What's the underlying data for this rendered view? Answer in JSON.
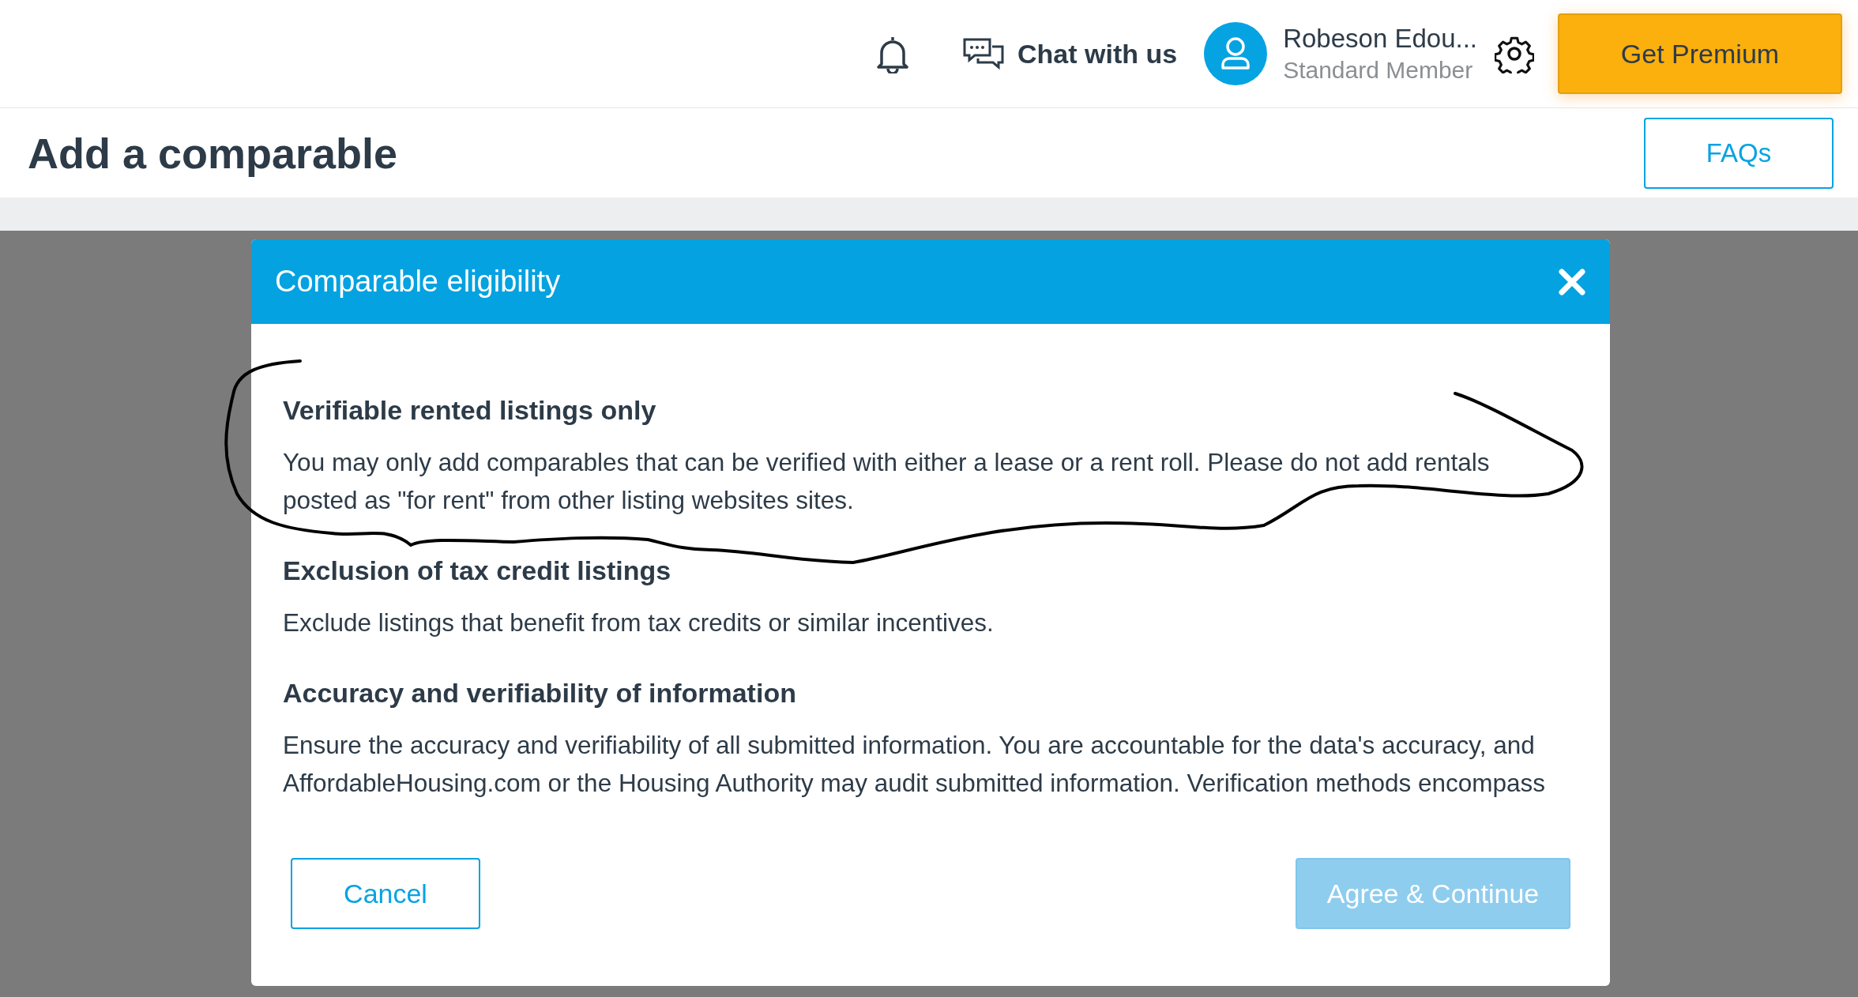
{
  "topbar": {
    "chat_label": "Chat with us",
    "user_name": "Robeson Edou...",
    "user_role": "Standard Member",
    "premium_button": "Get Premium"
  },
  "page": {
    "title": "Add a comparable",
    "faqs_button": "FAQs"
  },
  "modal": {
    "title": "Comparable eligibility",
    "sections": [
      {
        "heading": "Verifiable rented listings only",
        "text": "You may only add comparables that can be verified with either a lease or a rent roll. Please do not add rentals posted as \"for rent\" from other listing websites sites."
      },
      {
        "heading": "Exclusion of tax credit listings",
        "text": "Exclude listings that benefit from tax credits or similar incentives."
      },
      {
        "heading": "Accuracy and verifiability of information",
        "text": "Ensure the accuracy and verifiability of all submitted information. You are accountable for the data's accuracy, and AffordableHousing.com or the Housing Authority may audit submitted information. Verification methods encompass"
      }
    ],
    "cancel_button": "Cancel",
    "agree_button": {
      "label": "Agree & Continue",
      "disabled": true
    }
  },
  "annotation": {
    "kind": "scribble"
  }
}
